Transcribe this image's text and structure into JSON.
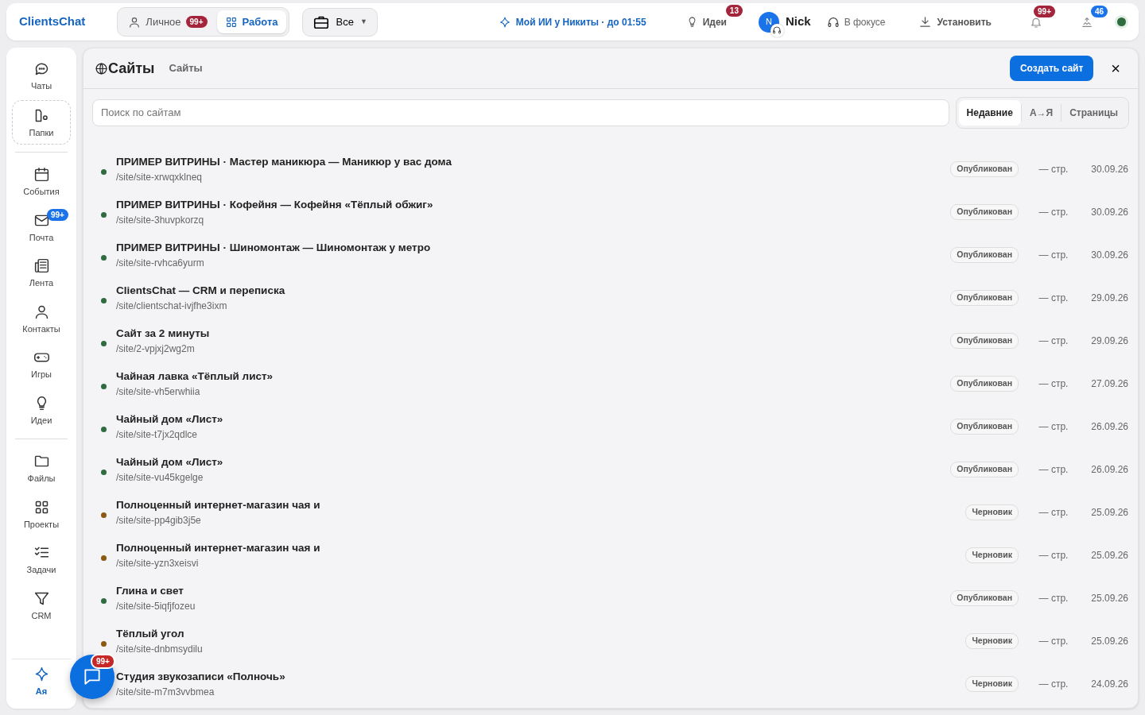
{
  "topbar": {
    "brand": "ClientsChat",
    "modes": [
      {
        "label": "Личное",
        "badge": "99+",
        "selected": false
      },
      {
        "label": "Работа",
        "selected": true
      }
    ],
    "workspace": "Все",
    "workspace_caret": "▼",
    "ai_link": "Мой ИИ у Никиты · до 01:55",
    "ideas": {
      "label": "Идеи",
      "badge": "13"
    },
    "user": {
      "initials": "N",
      "name": "Nick"
    },
    "focus": "В фокусе",
    "install": "Установить",
    "notifications_badge": "99+",
    "updates_badge": "46"
  },
  "sidebar": {
    "items": [
      {
        "label": "Чаты",
        "selected": false
      },
      {
        "label": "Папки",
        "selected": false,
        "kind": "dashed"
      },
      {
        "kind": "divider"
      },
      {
        "label": "События",
        "selected": false
      },
      {
        "label": "Почта",
        "selected": false,
        "badge": "99+"
      },
      {
        "label": "Лента",
        "selected": false
      },
      {
        "label": "Контакты",
        "selected": false
      },
      {
        "label": "Игры",
        "selected": false
      },
      {
        "label": "Идеи",
        "selected": false
      },
      {
        "kind": "divider"
      },
      {
        "label": "Файлы",
        "selected": false
      },
      {
        "label": "Проекты",
        "selected": false
      },
      {
        "label": "Задачи",
        "selected": false
      },
      {
        "label": "CRM",
        "selected": false
      },
      {
        "label": "Ая",
        "selected": true
      }
    ]
  },
  "panel": {
    "title": "Сайты",
    "breadcrumb": "Сайты",
    "create_button": "Создать сайт",
    "close": "×",
    "search": {
      "placeholder": "Поиск по сайтам"
    },
    "sort_tabs": [
      {
        "label": "Недавние",
        "selected": true
      },
      {
        "label": "А→Я",
        "selected": false
      },
      {
        "label": "Страницы",
        "selected": false
      }
    ],
    "sites": [
      {
        "title": "ПРИМЕР ВИТРИНЫ · Мастер маникюра — Маникюр у вас дома",
        "path": "/site/site-xrwqxklneq",
        "status": "Опубликован",
        "kind": "published",
        "pages": "— стр.",
        "date": "30.09.26"
      },
      {
        "title": "ПРИМЕР ВИТРИНЫ · Кофейня — Кофейня «Тёплый обжиг»",
        "path": "/site/site-3huvpkorzq",
        "status": "Опубликован",
        "kind": "published",
        "pages": "— стр.",
        "date": "30.09.26"
      },
      {
        "title": "ПРИМЕР ВИТРИНЫ · Шиномонтаж — Шиномонтаж у метро",
        "path": "/site/site-rvhca6yurm",
        "status": "Опубликован",
        "kind": "published",
        "pages": "— стр.",
        "date": "30.09.26"
      },
      {
        "title": "ClientsChat — CRM и переписка",
        "path": "/site/clientschat-ivjfhe3ixm",
        "status": "Опубликован",
        "kind": "published",
        "pages": "— стр.",
        "date": "29.09.26"
      },
      {
        "title": "Сайт за 2 минуты",
        "path": "/site/2-vpjxj2wg2m",
        "status": "Опубликован",
        "kind": "published",
        "pages": "— стр.",
        "date": "29.09.26"
      },
      {
        "title": "Чайная лавка «Тёплый лист»",
        "path": "/site/site-vh5erwhiia",
        "status": "Опубликован",
        "kind": "published",
        "pages": "— стр.",
        "date": "27.09.26"
      },
      {
        "title": "Чайный дом «Лист»",
        "path": "/site/site-t7jx2qdlce",
        "status": "Опубликован",
        "kind": "published",
        "pages": "— стр.",
        "date": "26.09.26"
      },
      {
        "title": "Чайный дом «Лист»",
        "path": "/site/site-vu45kgelge",
        "status": "Опубликован",
        "kind": "published",
        "pages": "— стр.",
        "date": "26.09.26"
      },
      {
        "title": "Полноценный интернет-магазин чая и",
        "path": "/site/site-pp4gib3j5e",
        "status": "Черновик",
        "kind": "draft",
        "pages": "— стр.",
        "date": "25.09.26"
      },
      {
        "title": "Полноценный интернет-магазин чая и",
        "path": "/site/site-yzn3xeisvi",
        "status": "Черновик",
        "kind": "draft",
        "pages": "— стр.",
        "date": "25.09.26"
      },
      {
        "title": "Глина и свет",
        "path": "/site/site-5iqfjfozeu",
        "status": "Опубликован",
        "kind": "published",
        "pages": "— стр.",
        "date": "25.09.26"
      },
      {
        "title": "Тёплый угол",
        "path": "/site/site-dnbmsydilu",
        "status": "Черновик",
        "kind": "draft",
        "pages": "— стр.",
        "date": "25.09.26"
      },
      {
        "title": "Студия звукозаписи «Полночь»",
        "path": "/site/site-m7m3vvbmea",
        "status": "Черновик",
        "pages": "— стр.",
        "date": "24.09.26"
      }
    ]
  },
  "chat_fab": {
    "badge": "99+"
  }
}
